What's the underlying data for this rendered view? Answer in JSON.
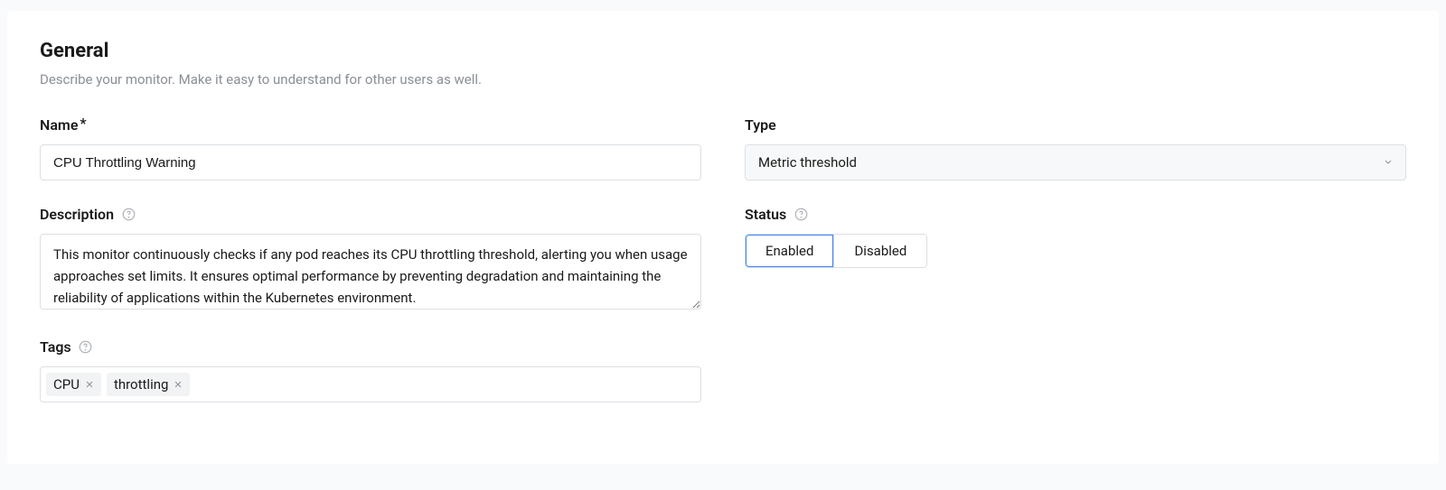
{
  "section": {
    "title": "General",
    "subtitle": "Describe your monitor. Make it easy to understand for other users as well."
  },
  "fields": {
    "name": {
      "label": "Name",
      "required_mark": "*",
      "value": "CPU Throttling Warning"
    },
    "description": {
      "label": "Description",
      "value": "This monitor continuously checks if any pod reaches its CPU throttling threshold, alerting you when usage approaches set limits. It ensures optimal performance by preventing degradation and maintaining the reliability of applications within the Kubernetes environment."
    },
    "tags": {
      "label": "Tags",
      "items": [
        {
          "text": "CPU"
        },
        {
          "text": "throttling"
        }
      ]
    },
    "type": {
      "label": "Type",
      "selected": "Metric threshold"
    },
    "status": {
      "label": "Status",
      "options": {
        "enabled": "Enabled",
        "disabled": "Disabled"
      },
      "active": "enabled"
    }
  }
}
